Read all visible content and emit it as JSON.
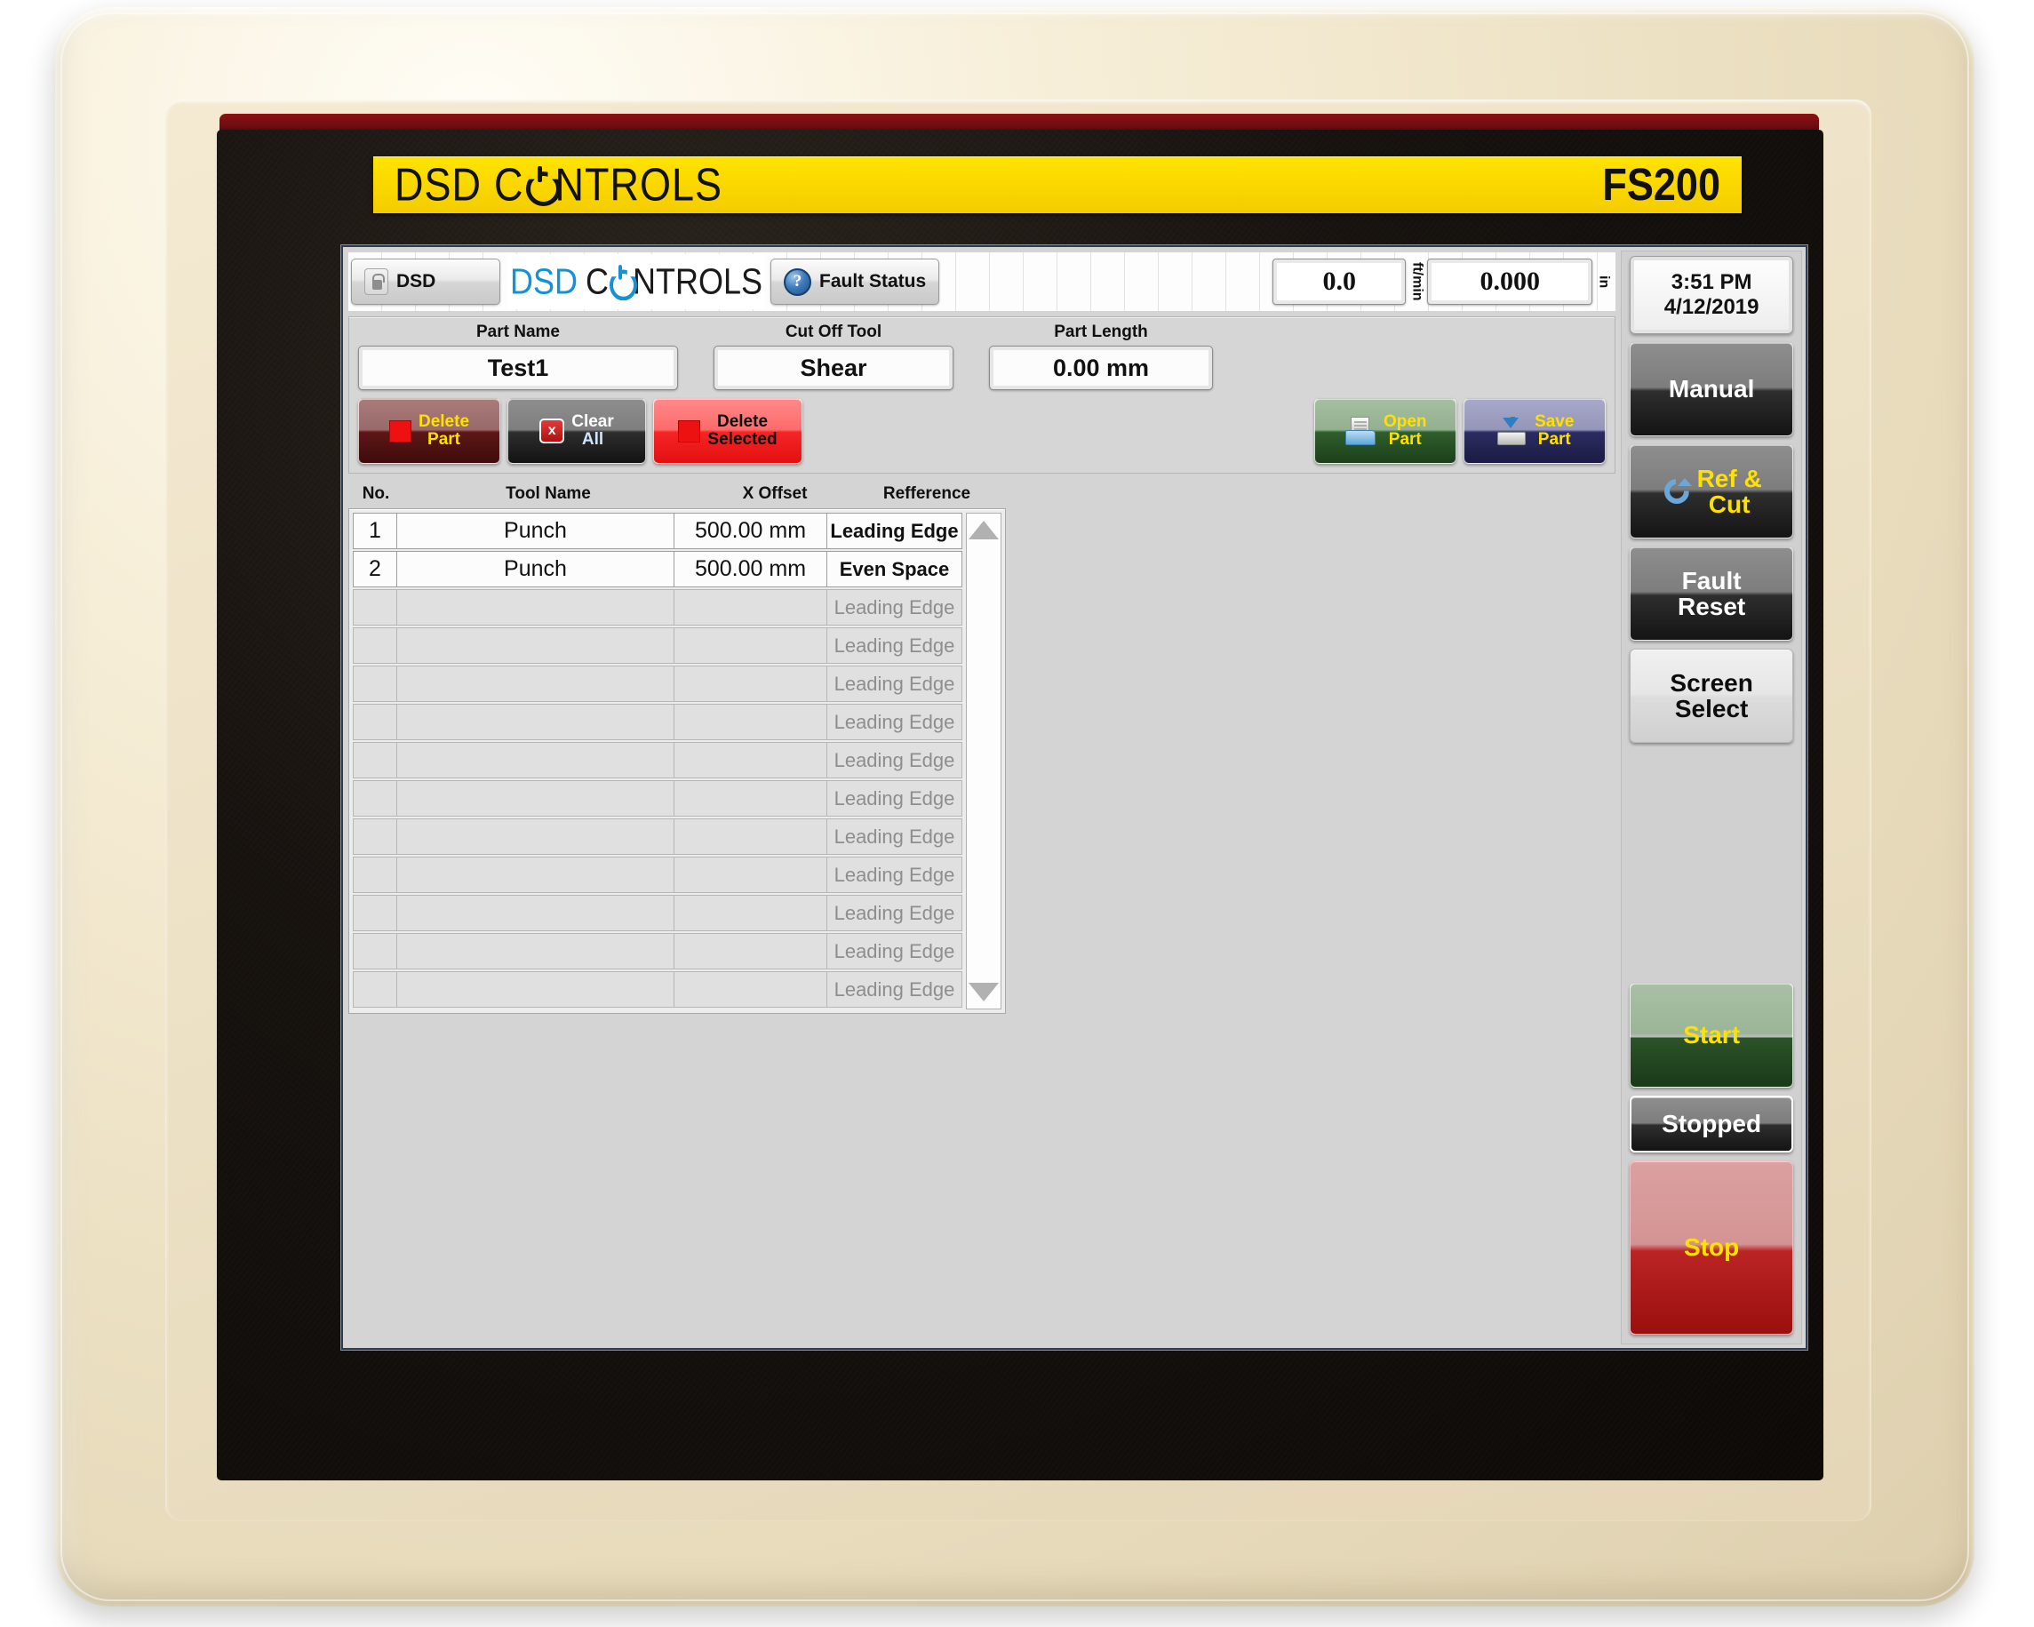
{
  "brand": {
    "name_first": "DSD",
    "name_second_a": "C",
    "name_second_b": "NTROLS",
    "model": "FS200"
  },
  "header": {
    "lock_button_label": "DSD",
    "logo_dsd": "DSD",
    "logo_c": "C",
    "logo_ntrols": "NTROLS",
    "fault_status_label": "Fault Status",
    "help_glyph": "?",
    "speed_value": "0.0",
    "speed_unit": "ft/min",
    "length_value": "0.000",
    "length_unit": "in"
  },
  "part": {
    "name_label": "Part Name",
    "name_value": "Test1",
    "tool_label": "Cut Off Tool",
    "tool_value": "Shear",
    "length_label": "Part Length",
    "length_value": "0.00 mm",
    "delete_part_l1": "Delete",
    "delete_part_l2": "Part",
    "clear_all_l1": "Clear",
    "clear_all_l2": "All",
    "clear_all_glyph": "x",
    "delete_selected_l1": "Delete",
    "delete_selected_l2": "Selected",
    "open_part_l1": "Open",
    "open_part_l2": "Part",
    "save_part_l1": "Save",
    "save_part_l2": "Part"
  },
  "table": {
    "columns": [
      "No.",
      "Tool Name",
      "X Offset",
      "Refference"
    ],
    "rows": [
      {
        "no": "1",
        "tool": "Punch",
        "offset": "500.00 mm",
        "reference": "Leading Edge",
        "filled": true
      },
      {
        "no": "2",
        "tool": "Punch",
        "offset": "500.00 mm",
        "reference": "Even Space",
        "filled": true
      },
      {
        "no": "",
        "tool": "",
        "offset": "",
        "reference": "Leading Edge",
        "filled": false
      },
      {
        "no": "",
        "tool": "",
        "offset": "",
        "reference": "Leading Edge",
        "filled": false
      },
      {
        "no": "",
        "tool": "",
        "offset": "",
        "reference": "Leading Edge",
        "filled": false
      },
      {
        "no": "",
        "tool": "",
        "offset": "",
        "reference": "Leading Edge",
        "filled": false
      },
      {
        "no": "",
        "tool": "",
        "offset": "",
        "reference": "Leading Edge",
        "filled": false
      },
      {
        "no": "",
        "tool": "",
        "offset": "",
        "reference": "Leading Edge",
        "filled": false
      },
      {
        "no": "",
        "tool": "",
        "offset": "",
        "reference": "Leading Edge",
        "filled": false
      },
      {
        "no": "",
        "tool": "",
        "offset": "",
        "reference": "Leading Edge",
        "filled": false
      },
      {
        "no": "",
        "tool": "",
        "offset": "",
        "reference": "Leading Edge",
        "filled": false
      },
      {
        "no": "",
        "tool": "",
        "offset": "",
        "reference": "Leading Edge",
        "filled": false
      },
      {
        "no": "",
        "tool": "",
        "offset": "",
        "reference": "Leading Edge",
        "filled": false
      }
    ]
  },
  "sidebar": {
    "clock_time": "3:51 PM",
    "clock_date": "4/12/2019",
    "manual_label": "Manual",
    "ref_cut_l1": "Ref &",
    "ref_cut_l2": "Cut",
    "fault_reset_l1": "Fault",
    "fault_reset_l2": "Reset",
    "screen_select_l1": "Screen",
    "screen_select_l2": "Select",
    "start_label": "Start",
    "stopped_label": "Stopped",
    "stop_label": "Stop"
  },
  "colors": {
    "brand_yellow": "#fbd800",
    "accent_blue": "#1592d6",
    "danger_red": "#bb2424",
    "go_green": "#2c5329",
    "label_yellow": "#ffe100"
  }
}
